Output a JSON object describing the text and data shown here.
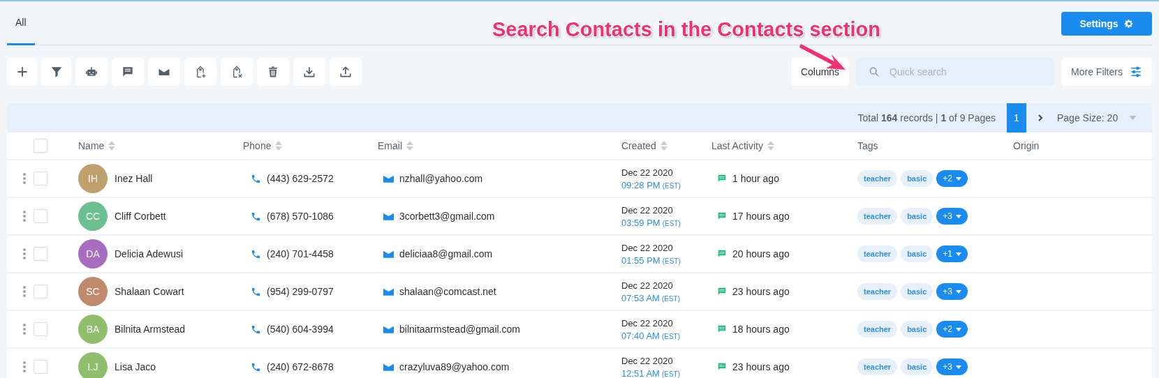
{
  "tabs": [
    {
      "label": "All",
      "selected": true
    }
  ],
  "settings_button": {
    "label": "Settings"
  },
  "annotation": {
    "text": "Search Contacts in the Contacts section"
  },
  "toolbar": [
    {
      "kind": "add"
    },
    {
      "kind": "filter"
    },
    {
      "kind": "robot"
    },
    {
      "kind": "chat"
    },
    {
      "kind": "mail"
    },
    {
      "kind": "tag-add"
    },
    {
      "kind": "tag-remove"
    },
    {
      "kind": "trash"
    },
    {
      "kind": "download"
    },
    {
      "kind": "upload"
    }
  ],
  "columns_button": {
    "label": "Columns"
  },
  "search": {
    "placeholder": "Quick search"
  },
  "more_filters": {
    "label": "More Filters"
  },
  "pagination": {
    "summary": "Total **164** records | **1** of 9 Pages",
    "pages": [
      {
        "label": "1",
        "selected": true
      }
    ],
    "page_size": "Page Size: 20"
  },
  "table": {
    "select_all_checked": false,
    "columns": [
      {
        "label": "Name",
        "sortable": true
      },
      {
        "label": "Phone",
        "sortable": true
      },
      {
        "label": "Email",
        "sortable": true
      },
      {
        "label": "Created",
        "sortable": true
      },
      {
        "label": "Last Activity",
        "sortable": true
      },
      {
        "label": "Tags",
        "sortable": false
      },
      {
        "label": "Origin",
        "sortable": false
      }
    ],
    "rows": [
      {
        "initials": "IH",
        "color": "#bf9f6c",
        "name": "Inez Hall",
        "phone": "(443) 629-2572",
        "email": "nzhall@yahoo.com",
        "date": "Dec 22 2020",
        "time": "09:28 PM",
        "tz": "(EST)",
        "activity": "1 hour ago",
        "tags": [
          "teacher",
          "basic"
        ],
        "more": "+2",
        "checked": false
      },
      {
        "initials": "CC",
        "color": "#6cbf8f",
        "name": "Cliff Corbett",
        "phone": "(678) 570-1086",
        "email": "3corbett3@gmail.com",
        "date": "Dec 22 2020",
        "time": "03:59 PM",
        "tz": "(EST)",
        "activity": "17 hours ago",
        "tags": [
          "teacher",
          "basic"
        ],
        "more": "+3",
        "checked": false
      },
      {
        "initials": "DA",
        "color": "#a86cbf",
        "name": "Delicia Adewusi",
        "phone": "(240) 701-4458",
        "email": "deliciaa8@gmail.com",
        "date": "Dec 22 2020",
        "time": "01:55 PM",
        "tz": "(EST)",
        "activity": "20 hours ago",
        "tags": [
          "teacher",
          "basic"
        ],
        "more": "+1",
        "checked": false
      },
      {
        "initials": "SC",
        "color": "#bf8a6c",
        "name": "Shalaan Cowart",
        "phone": "(954) 299-0797",
        "email": "shalaan@comcast.net",
        "date": "Dec 22 2020",
        "time": "07:53 AM",
        "tz": "(EST)",
        "activity": "23 hours ago",
        "tags": [
          "teacher",
          "basic"
        ],
        "more": "+3",
        "checked": false
      },
      {
        "initials": "BA",
        "color": "#8fbf6c",
        "name": "Bilnita Armstead",
        "phone": "(540) 604-3994",
        "email": "bilnitaarmstead@gmail.com",
        "date": "Dec 22 2020",
        "time": "07:40 AM",
        "tz": "(EST)",
        "activity": "18 hours ago",
        "tags": [
          "teacher",
          "basic"
        ],
        "more": "+2",
        "checked": false
      },
      {
        "initials": "LJ",
        "color": "#8fbf6c",
        "name": "Lisa Jaco",
        "phone": "(240) 672-8678",
        "email": "crazyluva89@yahoo.com",
        "date": "Dec 22 2020",
        "time": "12:51 AM",
        "tz": "(EST)",
        "activity": "23 hours ago",
        "tags": [
          "teacher",
          "basic"
        ],
        "more": "+3",
        "checked": false
      }
    ]
  }
}
